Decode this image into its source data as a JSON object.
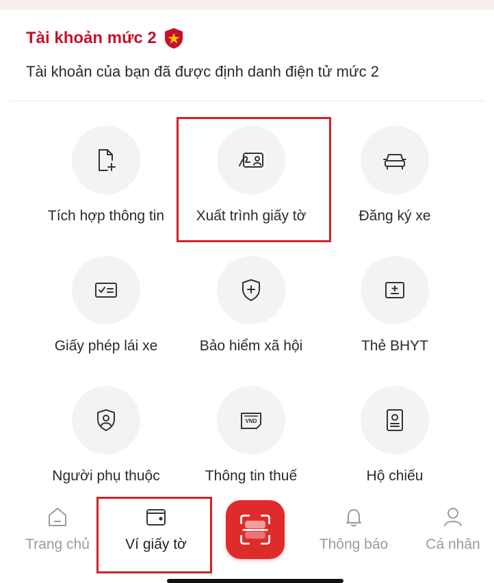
{
  "account": {
    "title": "Tài khoản mức 2",
    "description": "Tài khoản của bạn đã được định danh điện tử mức 2"
  },
  "services": [
    {
      "label": "Tích hợp thông tin",
      "icon": "document-add-icon"
    },
    {
      "label": "Xuất trình giấy tờ",
      "icon": "id-card-present-icon",
      "highlighted": true
    },
    {
      "label": "Đăng ký xe",
      "icon": "car-icon"
    },
    {
      "label": "Giấy phép lái xe",
      "icon": "license-check-icon"
    },
    {
      "label": "Bảo hiểm xã hội",
      "icon": "shield-plus-icon"
    },
    {
      "label": "Thẻ BHYT",
      "icon": "health-card-icon"
    },
    {
      "label": "Người phụ thuộc",
      "icon": "dependent-icon"
    },
    {
      "label": "Thông tin thuế",
      "icon": "tax-vnd-icon",
      "icon_text": "VND"
    },
    {
      "label": "Hộ chiếu",
      "icon": "passport-icon"
    }
  ],
  "bottom_nav": {
    "home": "Trang chủ",
    "wallet": "Ví giấy tờ",
    "notifications": "Thông báo",
    "profile": "Cá nhân",
    "active": "wallet"
  },
  "colors": {
    "brand_red": "#c8102e",
    "scan_red": "#e02b2b",
    "highlight_border": "#d61f26",
    "badge_gold": "#f6c400"
  }
}
